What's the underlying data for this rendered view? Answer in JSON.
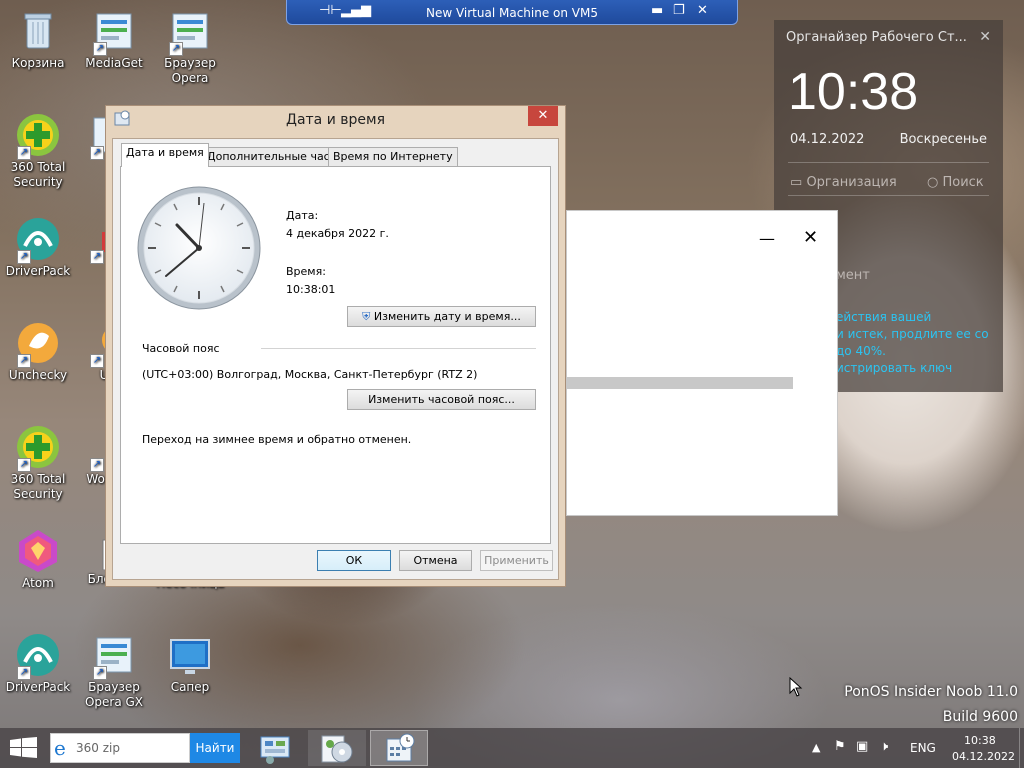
{
  "desktop": {
    "icons": [
      {
        "label": "Корзина",
        "icon": "recycle-bin-icon"
      },
      {
        "label": "MediaGet",
        "icon": "mediaget-icon"
      },
      {
        "label": "Браузер Opera",
        "icon": "opera-browser-icon"
      },
      {
        "label": "360 Total Security",
        "icon": "360-total-security-icon"
      },
      {
        "label": "H",
        "icon": "partial-icon"
      },
      {
        "label": "DriverPack",
        "icon": "driverpack-icon"
      },
      {
        "label": "U",
        "icon": "partial-icon"
      },
      {
        "label": "Unchecky",
        "icon": "unchecky-icon"
      },
      {
        "label": "Un",
        "icon": "partial-icon"
      },
      {
        "label": "360 Total Security",
        "icon": "360-total-security-icon"
      },
      {
        "label": "Wo T",
        "icon": "partial-icon"
      },
      {
        "label": "Atom",
        "icon": "atom-icon"
      },
      {
        "label": "Блокнот",
        "icon": "notepad-icon"
      },
      {
        "label": "Песочница",
        "icon": "sandbox-icon"
      },
      {
        "label": "DriverPack",
        "icon": "driverpack-icon"
      },
      {
        "label": "Браузер Opera GX",
        "icon": "opera-gx-icon"
      },
      {
        "label": "Сапер",
        "icon": "minesweeper-icon"
      }
    ]
  },
  "vm_bar": {
    "title": "New Virtual Machine on VM5"
  },
  "gadget": {
    "title": "Органайзер Рабочего Ст...",
    "time": "10:38",
    "date": "04.12.2022",
    "day": "Воскресенье",
    "link_org": "Организация",
    "link_search": "Поиск",
    "partial_label": "мент",
    "messages": [
      "ействия вашей",
      "и истек, продлите ее со",
      "до 40%.",
      "истрировать ключ"
    ],
    "message_color": "#2bc4f2"
  },
  "dialog": {
    "title": "Дата и время",
    "tabs": [
      "Дата и время",
      "Дополнительные часы",
      "Время по Интернету"
    ],
    "date_label": "Дата:",
    "date_value": "4 декабря 2022 г.",
    "time_label": "Время:",
    "time_value": "10:38:01",
    "change_datetime_btn": "Изменить дату и время...",
    "timezone_header": "Часовой пояс",
    "timezone_value": "(UTC+03:00) Волгоград, Москва, Санкт-Петербург (RTZ 2)",
    "change_tz_btn": "Изменить часовой пояс...",
    "dst_note": "Переход на зимнее время и обратно отменен.",
    "ok": "ОК",
    "cancel": "Отмена",
    "apply": "Применить"
  },
  "taskbar": {
    "search_value": "360 zip",
    "search_btn": "Найти",
    "lang": "ENG",
    "clock_time": "10:38",
    "clock_date": "04.12.2022"
  },
  "branding": {
    "line1": "PonOS Insider Noob 11.0",
    "line2": "Build 9600"
  }
}
